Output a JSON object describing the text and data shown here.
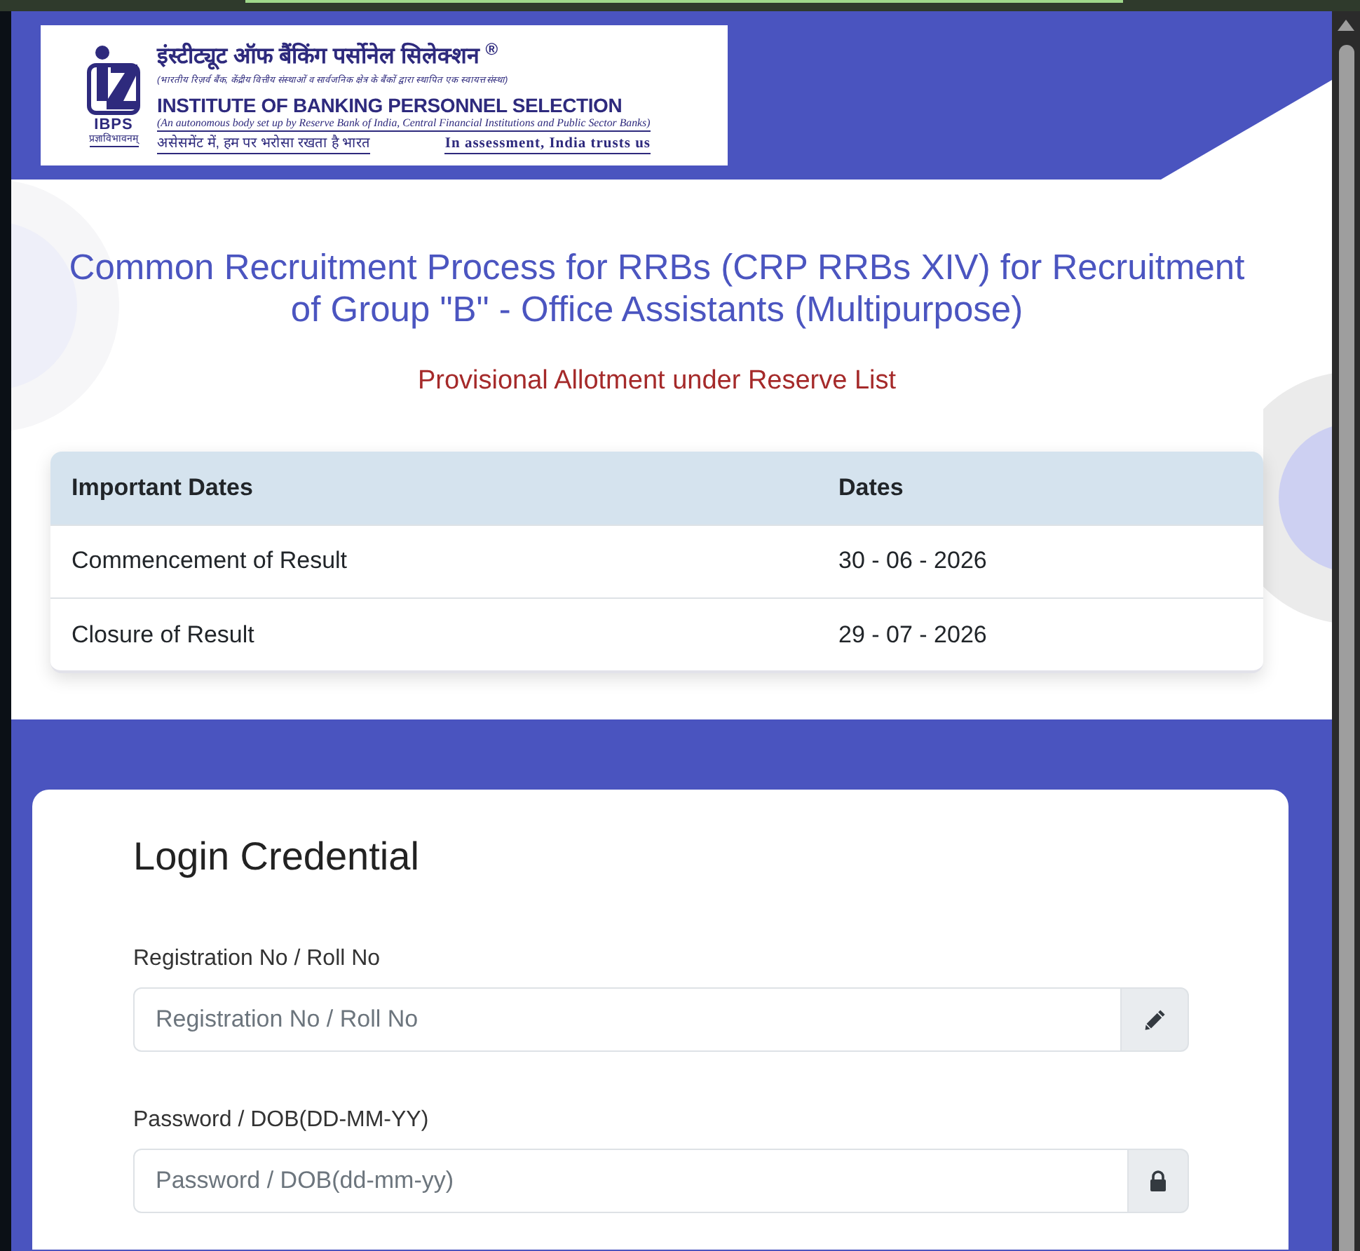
{
  "header": {
    "logo": {
      "emblem_text": "IBPS",
      "emblem_motto": "प्रज्ञाविभावनम्",
      "hindi_name": "इंस्टीट्यूट ऑफ बैंकिंग पर्सोनेल सिलेक्शन $^{®}$",
      "hindi_subtitle": "(भारतीय रिज़र्व बैंक, केंद्रीय वित्तीय संस्थाओं व सार्वजनिक क्षेत्र के बैंकों द्वारा स्थापित एक स्वायत्त संस्था)",
      "english_name": "INSTITUTE OF BANKING PERSONNEL SELECTION",
      "english_subtitle": "(An autonomous body set up by Reserve Bank of India, Central Financial Institutions and Public Sector Banks)",
      "hindi_tagline": "असेसमेंट में, हम पर भरोसा रखता है भारत",
      "english_tagline": "In assessment, India trusts us"
    }
  },
  "title": "Common Recruitment Process for RRBs (CRP RRBs XIV) for Recruitment of Group \"B\" - Office Assistants (Multipurpose)",
  "subtitle": "Provisional Allotment under Reserve List",
  "dates_table": {
    "columns": [
      "Important Dates",
      "Dates"
    ],
    "rows": [
      [
        "Commencement of Result",
        "30 - 06 - 2026"
      ],
      [
        "Closure of Result",
        "29 - 07 - 2026"
      ]
    ]
  },
  "login": {
    "title": "Login Credential",
    "fields": [
      {
        "kind": "text",
        "label": "Registration No / Roll No",
        "placeholder": "Registration No / Roll No"
      },
      {
        "kind": "password",
        "label": "Password / DOB(DD-MM-YY)",
        "placeholder": "Password / DOB(dd-mm-yy)"
      }
    ]
  }
}
